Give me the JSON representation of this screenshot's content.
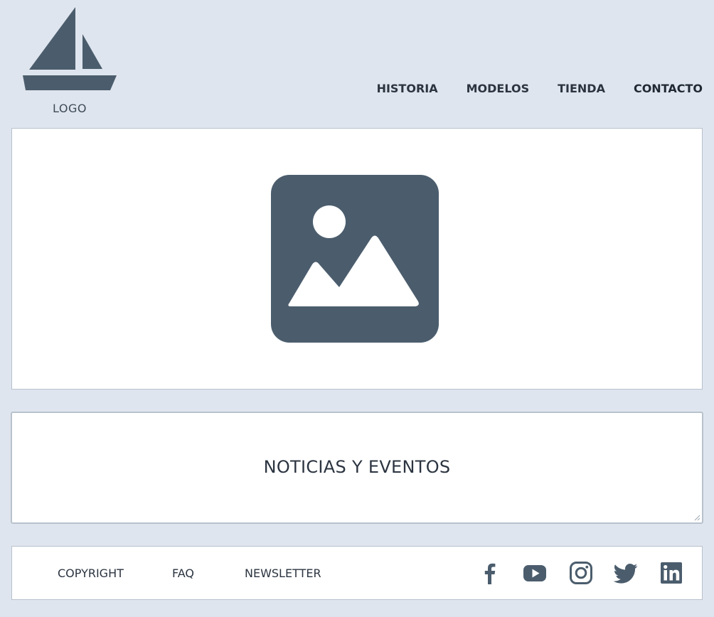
{
  "logo": {
    "label": "LOGO",
    "icon": "sailboat-icon",
    "color": "#4b5d6d"
  },
  "nav": {
    "items": [
      "HISTORIA",
      "MODELOS",
      "TIENDA",
      "CONTACTO"
    ]
  },
  "hero": {
    "icon": "image-placeholder-icon",
    "icon_color": "#4b5d6d"
  },
  "news": {
    "title": "NOTICIAS Y EVENTOS"
  },
  "footer": {
    "links": [
      "COPYRIGHT",
      "FAQ",
      "NEWSLETTER"
    ],
    "social": [
      "facebook-icon",
      "youtube-icon",
      "instagram-icon",
      "twitter-icon",
      "linkedin-icon"
    ],
    "icon_color": "#4b5d6d"
  },
  "colors": {
    "background": "#dfe5ee",
    "panel": "#ffffff",
    "border": "#b8c2cd",
    "text": "#2b3440"
  }
}
